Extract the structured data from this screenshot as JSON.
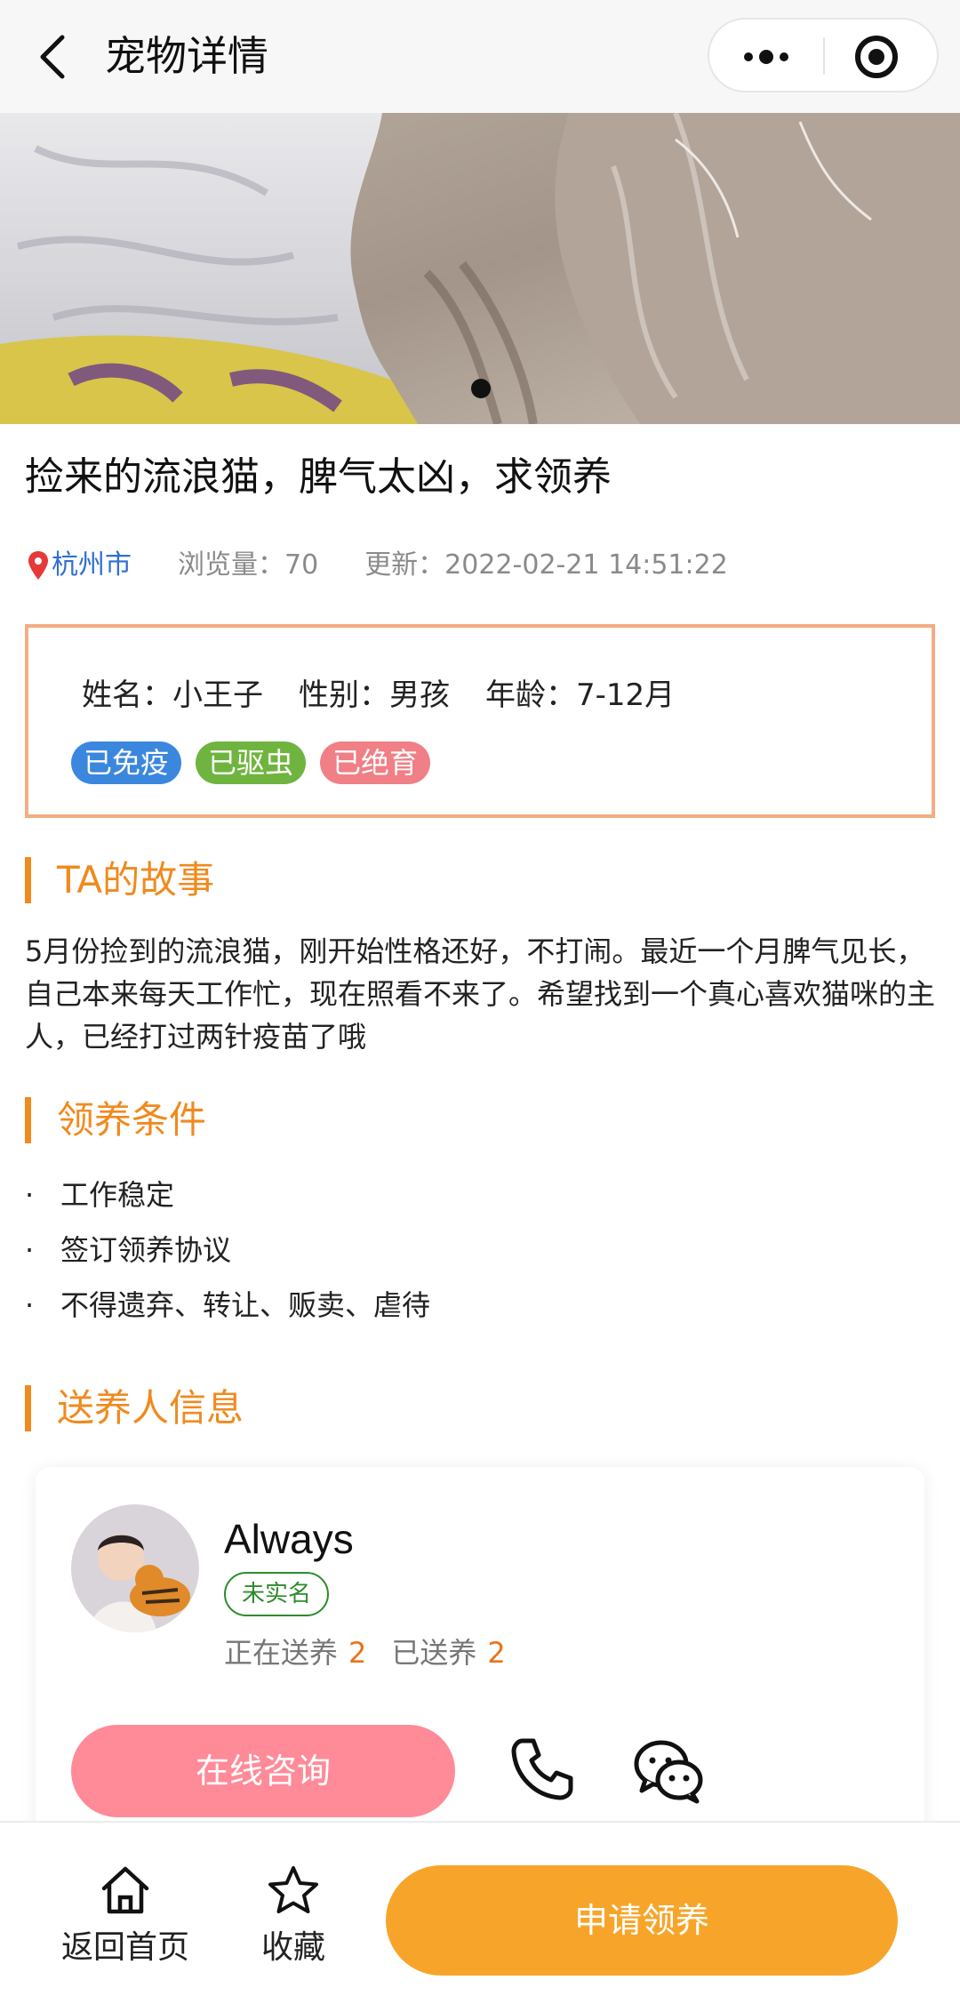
{
  "nav": {
    "title": "宠物详情"
  },
  "pet": {
    "title": "捡来的流浪猫，脾气太凶，求领养",
    "city": "杭州市",
    "views": "浏览量：70",
    "updated": "更新：2022-02-21 14:51:22",
    "name": "姓名：小王子",
    "gender": "性别：男孩",
    "age": "年龄：7-12月",
    "tags": [
      {
        "label": "已免疫",
        "color": "#3b87de"
      },
      {
        "label": "已驱虫",
        "color": "#6fb43f"
      },
      {
        "label": "已绝育",
        "color": "#f07f86"
      }
    ]
  },
  "story": {
    "heading": "TA的故事",
    "text": "5月份捡到的流浪猫，刚开始性格还好，不打闹。最近一个月脾气见长，自己本来每天工作忙，现在照看不来了。希望找到一个真心喜欢猫咪的主人，已经打过两针疫苗了哦"
  },
  "conditions": {
    "heading": "领养条件",
    "items": [
      "工作稳定",
      "签订领养协议",
      "不得遗弃、转让、贩卖、虐待"
    ]
  },
  "owner": {
    "heading": "送养人信息",
    "name": "Always",
    "verify": "未实名",
    "giving_label": "正在送养",
    "giving_count": "2",
    "given_label": "已送养",
    "given_count": "2",
    "consult_label": "在线咨询"
  },
  "bottom": {
    "home_label": "返回首页",
    "fav_label": "收藏",
    "apply_label": "申请领养"
  },
  "colors": {
    "accent": "#f08a1e",
    "apply": "#f7a52a",
    "consult": "#ff8a98",
    "verify": "#2e8b2e"
  },
  "icons": [
    "back-icon",
    "more-icon",
    "close-circle-icon",
    "location-pin-icon",
    "phone-icon",
    "wechat-icon",
    "home-icon",
    "star-icon"
  ]
}
